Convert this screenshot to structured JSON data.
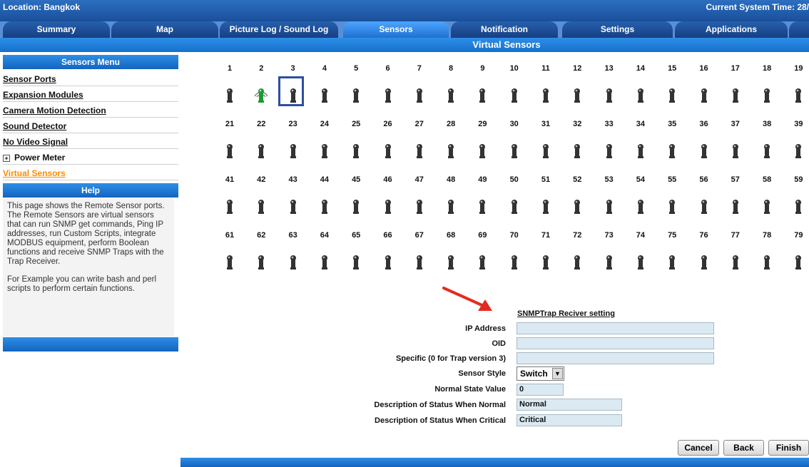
{
  "header": {
    "location": "Location: Bangkok",
    "time": "Current System Time: 28/"
  },
  "tabs": [
    "Summary",
    "Map",
    "Picture Log / Sound Log",
    "Sensors",
    "Notification",
    "Settings",
    "Applications"
  ],
  "active_tab": "Sensors",
  "page_title": "Virtual Sensors",
  "sidebar": {
    "menu_title": "Sensors Menu",
    "items": [
      "Sensor Ports",
      "Expansion Modules",
      "Camera Motion Detection",
      "Sound Detector",
      "No Video Signal",
      "Power Meter",
      "Virtual Sensors"
    ],
    "active_item": "Virtual Sensors",
    "help_title": "Help",
    "help_p1": "This page shows the Remote Sensor ports. The Remote Sensors are virtual sensors that can run SNMP get commands, Ping IP addresses, run Custom Scripts, integrate MODBUS equipment, perform Boolean functions and receive SNMP Traps with the Trap Receiver.",
    "help_p2": "For Example you can write bash and perl scripts to perform certain functions."
  },
  "sensor_rows": [
    [
      "1",
      "2",
      "3",
      "4",
      "5",
      "6",
      "7",
      "8",
      "9",
      "10",
      "11",
      "12",
      "13",
      "14",
      "15",
      "16",
      "17",
      "18",
      "19"
    ],
    [
      "21",
      "22",
      "23",
      "24",
      "25",
      "26",
      "27",
      "28",
      "29",
      "30",
      "31",
      "32",
      "33",
      "34",
      "35",
      "36",
      "37",
      "38",
      "39"
    ],
    [
      "41",
      "42",
      "43",
      "44",
      "45",
      "46",
      "47",
      "48",
      "49",
      "50",
      "51",
      "52",
      "53",
      "54",
      "55",
      "56",
      "57",
      "58",
      "59"
    ],
    [
      "61",
      "62",
      "63",
      "64",
      "65",
      "66",
      "67",
      "68",
      "69",
      "70",
      "71",
      "72",
      "73",
      "74",
      "75",
      "76",
      "77",
      "78",
      "79"
    ]
  ],
  "active_sensor": "2",
  "selected_sensor": "3",
  "colors": {
    "active_sensor": "#1a9c2e",
    "inactive_sensor": "#333333",
    "highlight": "#ff8a00"
  },
  "form": {
    "heading": "SNMPTrap Reciver setting",
    "ip_label": "IP Address",
    "ip_value": "",
    "oid_label": "OID",
    "oid_value": "",
    "specific_label": "Specific (0 for Trap version 3)",
    "specific_value": "",
    "style_label": "Sensor Style",
    "style_value": "Switch",
    "normal_state_label": "Normal State Value",
    "normal_state_value": "0",
    "desc_normal_label": "Description of Status When Normal",
    "desc_normal_value": "Normal",
    "desc_critical_label": "Description of Status When Critical",
    "desc_critical_value": "Critical"
  },
  "buttons": {
    "cancel": "Cancel",
    "back": "Back",
    "finish": "Finish"
  }
}
